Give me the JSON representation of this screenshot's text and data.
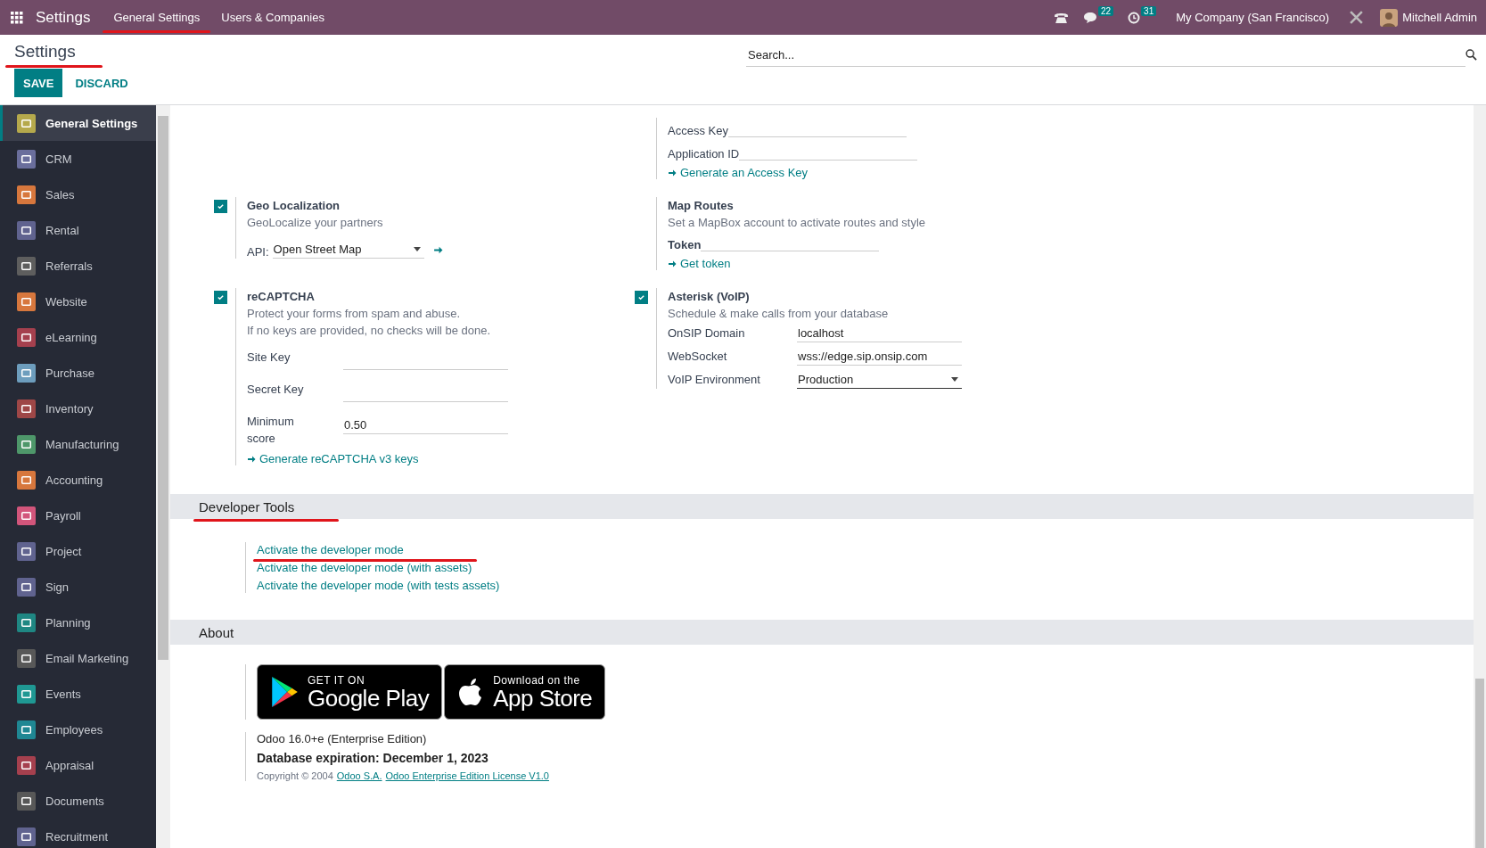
{
  "navbar": {
    "app_name": "Settings",
    "menu": [
      {
        "label": "General Settings",
        "annotated": true
      },
      {
        "label": "Users & Companies",
        "annotated": false
      }
    ],
    "messages_badge": "22",
    "activities_badge": "31",
    "company": "My Company (San Francisco)",
    "user": "Mitchell Admin"
  },
  "control_panel": {
    "title": "Settings",
    "title_annotated": true,
    "buttons": [
      {
        "label": "SAVE",
        "kind": "primary"
      },
      {
        "label": "DISCARD",
        "kind": "secondary"
      }
    ],
    "search": {
      "placeholder": "Search..."
    }
  },
  "sidebar": {
    "items": [
      {
        "label": "General Settings",
        "selected": true,
        "color": "#b5a94c"
      },
      {
        "label": "CRM",
        "selected": false,
        "color": "#6a6e9c"
      },
      {
        "label": "Sales",
        "selected": false,
        "color": "#d7773d"
      },
      {
        "label": "Rental",
        "selected": false,
        "color": "#60638f"
      },
      {
        "label": "Referrals",
        "selected": false,
        "color": "#5e5e5e"
      },
      {
        "label": "Website",
        "selected": false,
        "color": "#d7773d"
      },
      {
        "label": "eLearning",
        "selected": false,
        "color": "#a5404e"
      },
      {
        "label": "Purchase",
        "selected": false,
        "color": "#6d9dbd"
      },
      {
        "label": "Inventory",
        "selected": false,
        "color": "#9e4747"
      },
      {
        "label": "Manufacturing",
        "selected": false,
        "color": "#4e976a"
      },
      {
        "label": "Accounting",
        "selected": false,
        "color": "#d7773d"
      },
      {
        "label": "Payroll",
        "selected": false,
        "color": "#d2557b"
      },
      {
        "label": "Project",
        "selected": false,
        "color": "#60638f"
      },
      {
        "label": "Sign",
        "selected": false,
        "color": "#60638f"
      },
      {
        "label": "Planning",
        "selected": false,
        "color": "#1f8783"
      },
      {
        "label": "Email Marketing",
        "selected": false,
        "color": "#585858"
      },
      {
        "label": "Events",
        "selected": false,
        "color": "#1f9893"
      },
      {
        "label": "Employees",
        "selected": false,
        "color": "#1f8793"
      },
      {
        "label": "Appraisal",
        "selected": false,
        "color": "#a5404e"
      },
      {
        "label": "Documents",
        "selected": false,
        "color": "#585858"
      },
      {
        "label": "Recruitment",
        "selected": false,
        "color": "#60638f"
      }
    ]
  },
  "settings_rows": [
    {
      "right": {
        "kind": "plain",
        "fields": [
          {
            "label": "Access Key",
            "kind": "inline_input",
            "bold": false
          },
          {
            "label": "Application ID",
            "kind": "inline_input",
            "bold": false
          }
        ],
        "links": [
          "Generate an Access Key"
        ]
      }
    },
    {
      "left": {
        "kind": "toggle",
        "checked": true,
        "title": "Geo Localization",
        "descriptions": [
          "GeoLocalize your partners"
        ],
        "fields": [
          {
            "label": "API:",
            "kind": "inline_select",
            "value": "Open Street Map",
            "bold": false
          }
        ]
      },
      "right": {
        "kind": "plain",
        "title": "Map Routes",
        "descriptions": [
          "Set a MapBox account to activate routes and style"
        ],
        "fields": [
          {
            "label": "Token",
            "kind": "inline_input",
            "bold": true
          }
        ],
        "links": [
          "Get token"
        ]
      }
    },
    {
      "left": {
        "kind": "toggle",
        "checked": true,
        "title": "reCAPTCHA",
        "descriptions": [
          "Protect your forms from spam and abuse.",
          "If no keys are provided, no checks will be done."
        ],
        "fields": [
          {
            "label": "Site Key",
            "kind": "input",
            "bold": false
          },
          {
            "label": "Secret Key",
            "kind": "input",
            "bold": false
          },
          {
            "label": "Minimum score",
            "kind": "input",
            "value": "0.50",
            "bold": false
          }
        ],
        "links": [
          "Generate reCAPTCHA v3 keys"
        ]
      },
      "right": {
        "kind": "toggle",
        "checked": true,
        "title": "Asterisk (VoIP)",
        "descriptions": [
          "Schedule & make calls from your database"
        ],
        "fields": [
          {
            "label": "OnSIP Domain",
            "kind": "input",
            "value": "localhost",
            "bold": false
          },
          {
            "label": "WebSocket",
            "kind": "input",
            "value": "wss://edge.sip.onsip.com",
            "bold": false
          },
          {
            "label": "VoIP Environment",
            "kind": "select",
            "value": "Production",
            "bold": false
          }
        ]
      }
    }
  ],
  "developer_tools": {
    "title": "Developer Tools",
    "title_annotated": true,
    "links": [
      {
        "label": "Activate the developer mode",
        "annotated": true
      },
      {
        "label": "Activate the developer mode (with assets)",
        "annotated": false
      },
      {
        "label": "Activate the developer mode (with tests assets)",
        "annotated": false
      }
    ]
  },
  "about": {
    "title": "About",
    "store_badges": [
      {
        "kind": "google",
        "small": "GET IT ON",
        "large": "Google Play"
      },
      {
        "kind": "apple",
        "small": "Download on the",
        "large": "App Store"
      }
    ],
    "version": "Odoo 16.0+e (Enterprise Edition)",
    "expiration": "Database expiration: December 1, 2023",
    "copyright": "Copyright © 2004",
    "copyright_links": [
      "Odoo S.A.",
      "Odoo Enterprise Edition License V1.0"
    ]
  }
}
